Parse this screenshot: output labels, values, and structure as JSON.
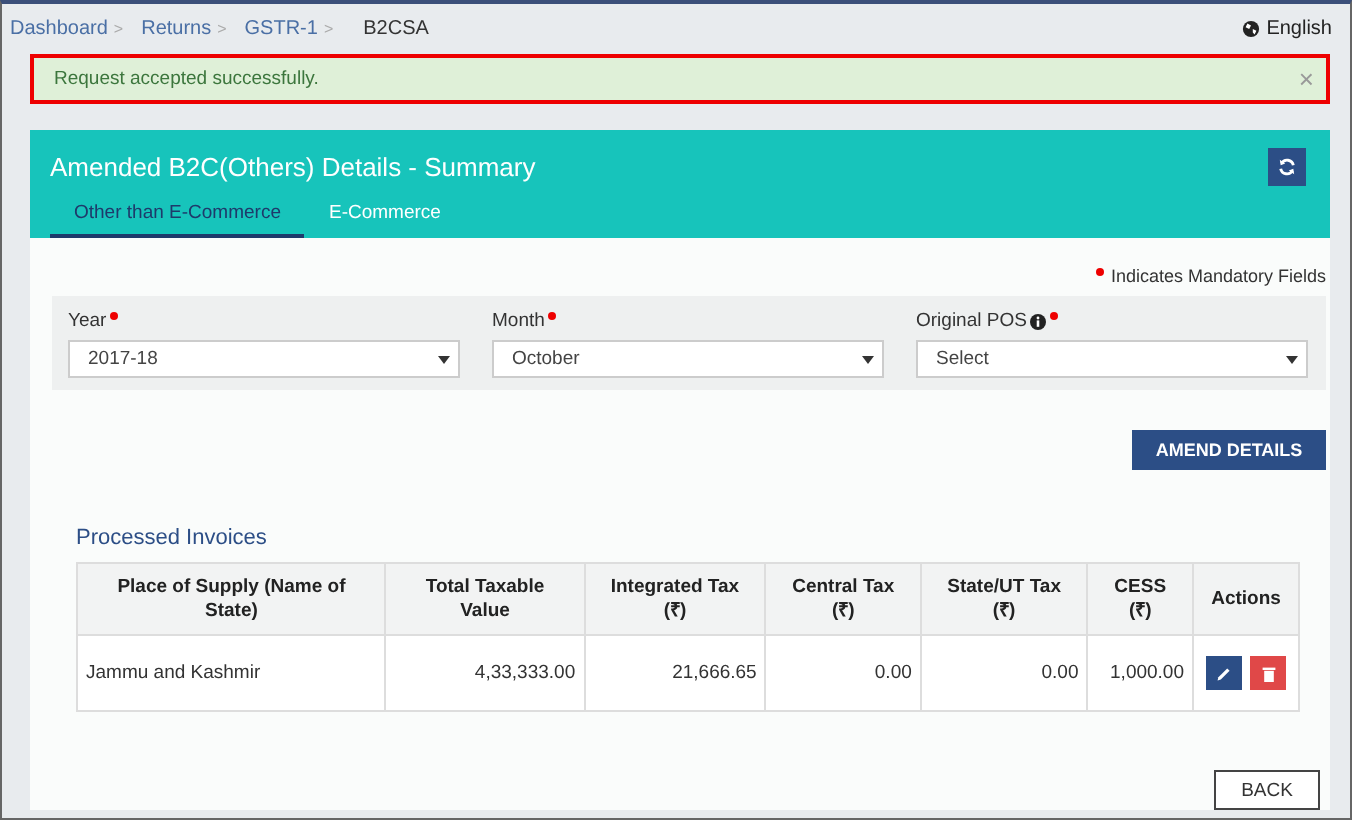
{
  "breadcrumb": [
    {
      "label": "Dashboard",
      "link": true
    },
    {
      "label": "Returns",
      "link": true
    },
    {
      "label": "GSTR-1",
      "link": true
    },
    {
      "label": "B2CSA",
      "link": false
    }
  ],
  "separator": ">",
  "language": "English",
  "alert": {
    "message": "Request accepted successfully.",
    "close": "×"
  },
  "panel": {
    "title": "Amended B2C(Others) Details - Summary"
  },
  "tabs": [
    {
      "label": "Other than E-Commerce",
      "selected": true
    },
    {
      "label": "E-Commerce",
      "selected": false
    }
  ],
  "mandatory_note": "Indicates Mandatory Fields",
  "fields": [
    {
      "label": "Year",
      "required": true,
      "info": false,
      "value": "2017-18"
    },
    {
      "label": "Month",
      "required": true,
      "info": false,
      "value": "October"
    },
    {
      "label": "Original POS",
      "required": true,
      "info": true,
      "value": "Select"
    }
  ],
  "amend_button": "AMEND DETAILS",
  "table": {
    "title": "Processed Invoices",
    "columns": [
      "Place of Supply (Name of State)",
      "Total Taxable Value",
      "Integrated Tax (₹)",
      "Central Tax (₹)",
      "State/UT Tax (₹)",
      "CESS (₹)",
      "Actions"
    ],
    "rows": [
      {
        "cells": [
          "Jammu and Kashmir",
          "4,33,333.00",
          "21,666.65",
          "0.00",
          "0.00",
          "1,000.00"
        ]
      }
    ]
  },
  "back_button": "BACK"
}
